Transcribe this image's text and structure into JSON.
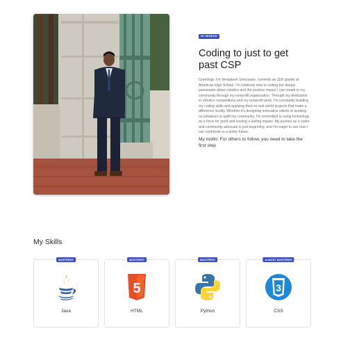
{
  "hero": {
    "badge": "MY MISSION",
    "title": "Coding to just to get past CSP",
    "body": "Greetings, I'm Venkatesh Srinivasan, currently an 11th grader at American High School. I'm relatively new to coding but deeply passionate about robotics and the positive impact I can create in my community through my nonprofit organization. Through my dedication to robotics competitions and my nonprofit work, I'm constantly building my coding skills and applying them to real-world projects that make a difference locally. Whether it's designing innovative robots or working on initiatives to uplift my community, I'm committed to using technology as a force for good and leaving a lasting impact. My journey as a coder and community advocate is just beginning, and I'm eager to see how I can contribute to a better future.",
    "motto": "My motto: For others to follow, you need to take the first step"
  },
  "skills": {
    "heading": "My Skills",
    "items": [
      {
        "name": "Java",
        "status": "MASTERED",
        "icon": "java-icon"
      },
      {
        "name": "HTML",
        "status": "MASTERED",
        "icon": "html5-icon"
      },
      {
        "name": "Python",
        "status": "MASTERED",
        "icon": "python-icon"
      },
      {
        "name": "CSS",
        "status": "ALMOST MASTERED",
        "icon": "css3-icon"
      }
    ]
  },
  "colors": {
    "badge": "#3a4fc4",
    "html_orange": "#e44d26",
    "css_blue": "#1e88d8",
    "python_blue": "#3776ab",
    "python_yellow": "#ffd43b"
  }
}
